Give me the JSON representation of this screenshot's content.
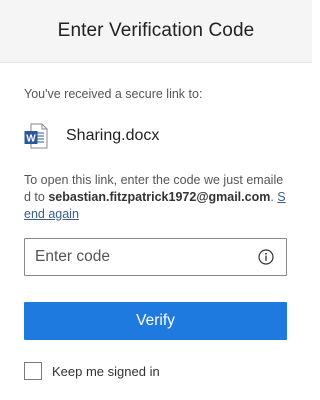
{
  "header": {
    "title": "Enter Verification Code"
  },
  "intro_text": "You've received a secure link to:",
  "file": {
    "name": "Sharing.docx",
    "icon": "word-document-icon",
    "icon_color": "#2b579a"
  },
  "instructions": {
    "prefix": "To open this link, enter the code we just emailed to ",
    "email": "sebastian.fitzpatrick1972@gmail.com",
    "period": ".",
    "send_again": "Send again"
  },
  "code_field": {
    "value": "",
    "placeholder": "Enter code",
    "info_icon": "info-icon"
  },
  "verify_button": {
    "label": "Verify",
    "color": "#1f7ae0"
  },
  "keep_signed_in": {
    "label": "Keep me signed in",
    "checked": false
  }
}
